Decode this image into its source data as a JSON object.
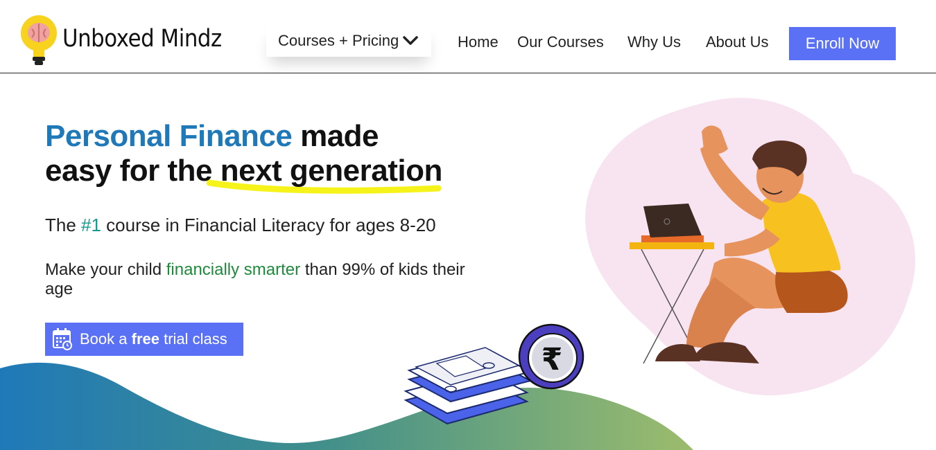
{
  "brand": {
    "name": "Unboxed Mindz",
    "logo_icon": "bulb-brain-icon"
  },
  "nav": {
    "dropdown_label": "Courses + Pricing",
    "dropdown_icon": "chevron-down-icon",
    "items": [
      "Home",
      "Our Courses",
      "Why Us",
      "About Us"
    ],
    "cta": "Enroll Now"
  },
  "hero": {
    "headline": {
      "part1_accent": "Personal Finance",
      "part2": " made",
      "part3": "easy for the ",
      "part4_highlight": "next generation"
    },
    "sub1": {
      "pre": "The ",
      "accent": "#1",
      "post": " course in Financial Literacy for ages 8-20"
    },
    "sub2": {
      "pre": "Make your child ",
      "accent": "financially smarter",
      "post": " than 99% of kids their age"
    },
    "cta": {
      "pre": "Book a ",
      "bold": "free",
      "post": " trial class",
      "icon": "calendar-icon"
    }
  },
  "illustrations": {
    "money": "money-stack-rupee-coin",
    "person": "boy-with-laptop-raising-hand"
  },
  "colors": {
    "accent_blue": "#1f79b8",
    "button_blue": "#5a70f5",
    "teal": "#139a8c",
    "green": "#1f8a3c",
    "highlight_yellow": "#f6f31a",
    "wave_start": "#1f79b8",
    "wave_end": "#8fb86a",
    "blob_pink": "#f8e4f1"
  }
}
